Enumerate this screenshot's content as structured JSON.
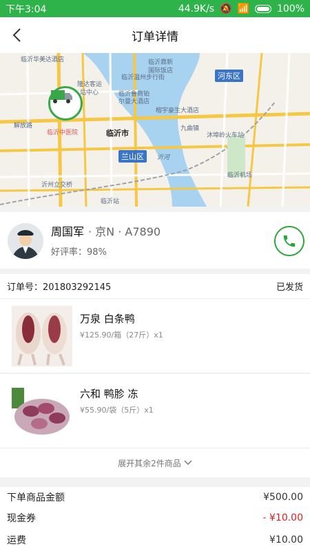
{
  "status_bar": {
    "time": "下午3:04",
    "speed": "44.9K/s",
    "battery": "100%"
  },
  "nav": {
    "title": "订单详情"
  },
  "map": {
    "labels": [
      "临沂华美达酒店",
      "隆达客运",
      "站中心",
      "临沂温州步行街",
      "临沂鼎新",
      "国际饭店",
      "临沂鲁商铂",
      "尔曼大酒店",
      "解放路",
      "临沂中医院",
      "临沂市",
      "兰山区",
      "沂河",
      "九曲镇",
      "沐埠岭火车站",
      "临沂机场",
      "沂州立交桥",
      "临沂站",
      "河东区",
      "榕宇豪生大酒店"
    ]
  },
  "driver": {
    "name": "周国军",
    "plate": "· 京N · A7890",
    "rating": "好评率：98%"
  },
  "order": {
    "label": "订单号：201803292145",
    "status": "已发货"
  },
  "items": [
    {
      "name": "万泉 白条鸭",
      "price": "¥125.90/箱（27斤）x1"
    },
    {
      "name": "六和 鸭胗 冻",
      "price": "¥55.90/袋（5斤）x1"
    }
  ],
  "expand_label": "展开其余2件商品",
  "summary": [
    {
      "label": "下单商品金额",
      "value": "¥500.00"
    },
    {
      "label": "现金券",
      "value": "- ¥10.00"
    },
    {
      "label": "运费",
      "value": "¥10.00"
    }
  ],
  "colors": {
    "accent": "#2db34a",
    "discount": "#e02020"
  }
}
